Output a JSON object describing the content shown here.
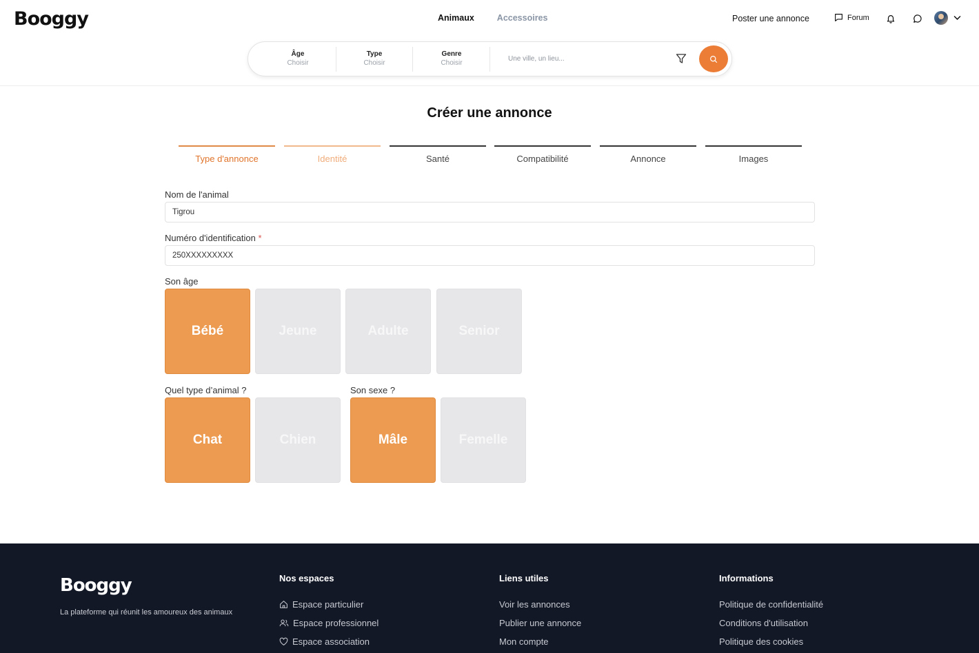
{
  "header": {
    "logo": "Booggy",
    "nav": {
      "animaux": "Animaux",
      "accessoires": "Accessoires"
    },
    "post_label": "Poster une annonce",
    "forum_label": "Forum"
  },
  "search": {
    "age": {
      "label": "Âge",
      "value": "Choisir"
    },
    "type": {
      "label": "Type",
      "value": "Choisir"
    },
    "genre": {
      "label": "Genre",
      "value": "Choisir"
    },
    "location_placeholder": "Une ville, un lieu..."
  },
  "form": {
    "title": "Créer une annonce",
    "steps": [
      "Type d'annonce",
      "Identité",
      "Santé",
      "Compatibilité",
      "Annonce",
      "Images"
    ],
    "name_label": "Nom de l'animal",
    "name_value": "Tigrou",
    "id_label": "Numéro d'identification",
    "id_required": "*",
    "id_value": "250XXXXXXXXX",
    "age_label": "Son âge",
    "age_options": [
      "Bébé",
      "Jeune",
      "Adulte",
      "Senior"
    ],
    "age_selected": "Bébé",
    "type_label": "Quel type d’animal ?",
    "type_options": [
      "Chat",
      "Chien"
    ],
    "type_selected": "Chat",
    "sex_label": "Son sexe ?",
    "sex_options": [
      "Mâle",
      "Femelle"
    ],
    "sex_selected": "Mâle"
  },
  "footer": {
    "logo": "Booggy",
    "tagline": "La plateforme qui réunit les amoureux des animaux",
    "col1": {
      "title": "Nos espaces",
      "items": [
        "Espace particulier",
        "Espace professionnel",
        "Espace association"
      ]
    },
    "col2": {
      "title": "Liens utiles",
      "items": [
        "Voir les annonces",
        "Publier une annonce",
        "Mon compte"
      ]
    },
    "col3": {
      "title": "Informations",
      "items": [
        "Politique de confidentialité",
        "Conditions d'utilisation",
        "Politique des cookies"
      ]
    }
  },
  "colors": {
    "accent": "#ec7d36",
    "tile_selected": "#ec9b51",
    "tile_unselected": "#e7e7ea",
    "footer_bg": "#131827"
  },
  "icons": [
    "chat-bubble-icon",
    "bell-icon",
    "message-icon",
    "chevron-down-icon",
    "filter-icon",
    "search-icon",
    "home-icon",
    "users-icon",
    "heart-icon"
  ]
}
